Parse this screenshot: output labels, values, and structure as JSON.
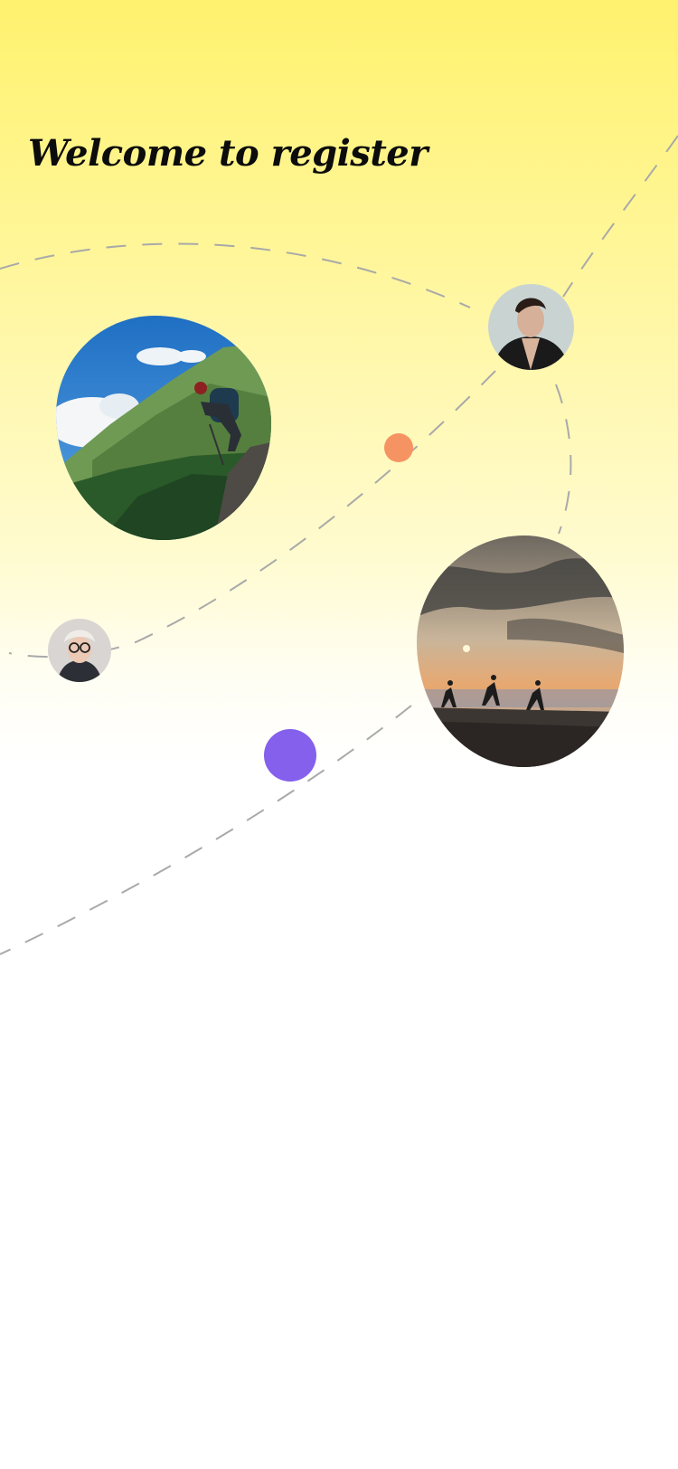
{
  "header": {
    "title": "Welcome to register"
  },
  "colors": {
    "background_top": "#fff26e",
    "background_bottom": "#ffffff",
    "dashed_path": "#a9a9a9",
    "accent_orange": "#f59462",
    "accent_purple": "#8460ed"
  },
  "images": [
    {
      "name": "hiker-mountain-photo",
      "description_icon": "photo-icon"
    },
    {
      "name": "hikers-sunset-photo",
      "description_icon": "photo-icon"
    }
  ],
  "avatars": [
    {
      "name": "avatar-man"
    },
    {
      "name": "avatar-woman-glasses"
    }
  ]
}
